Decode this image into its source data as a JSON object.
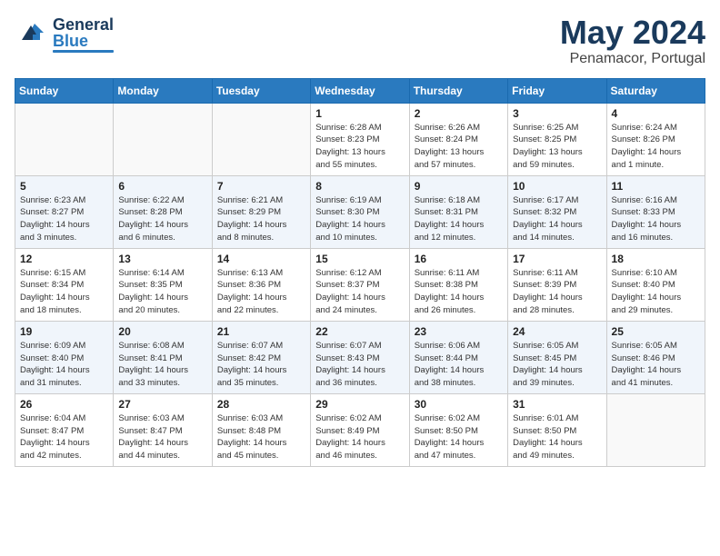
{
  "header": {
    "logo_general": "General",
    "logo_blue": "Blue",
    "month_title": "May 2024",
    "location": "Penamacor, Portugal"
  },
  "days_of_week": [
    "Sunday",
    "Monday",
    "Tuesday",
    "Wednesday",
    "Thursday",
    "Friday",
    "Saturday"
  ],
  "weeks": [
    [
      {
        "day": "",
        "info": ""
      },
      {
        "day": "",
        "info": ""
      },
      {
        "day": "",
        "info": ""
      },
      {
        "day": "1",
        "info": "Sunrise: 6:28 AM\nSunset: 8:23 PM\nDaylight: 13 hours\nand 55 minutes."
      },
      {
        "day": "2",
        "info": "Sunrise: 6:26 AM\nSunset: 8:24 PM\nDaylight: 13 hours\nand 57 minutes."
      },
      {
        "day": "3",
        "info": "Sunrise: 6:25 AM\nSunset: 8:25 PM\nDaylight: 13 hours\nand 59 minutes."
      },
      {
        "day": "4",
        "info": "Sunrise: 6:24 AM\nSunset: 8:26 PM\nDaylight: 14 hours\nand 1 minute."
      }
    ],
    [
      {
        "day": "5",
        "info": "Sunrise: 6:23 AM\nSunset: 8:27 PM\nDaylight: 14 hours\nand 3 minutes."
      },
      {
        "day": "6",
        "info": "Sunrise: 6:22 AM\nSunset: 8:28 PM\nDaylight: 14 hours\nand 6 minutes."
      },
      {
        "day": "7",
        "info": "Sunrise: 6:21 AM\nSunset: 8:29 PM\nDaylight: 14 hours\nand 8 minutes."
      },
      {
        "day": "8",
        "info": "Sunrise: 6:19 AM\nSunset: 8:30 PM\nDaylight: 14 hours\nand 10 minutes."
      },
      {
        "day": "9",
        "info": "Sunrise: 6:18 AM\nSunset: 8:31 PM\nDaylight: 14 hours\nand 12 minutes."
      },
      {
        "day": "10",
        "info": "Sunrise: 6:17 AM\nSunset: 8:32 PM\nDaylight: 14 hours\nand 14 minutes."
      },
      {
        "day": "11",
        "info": "Sunrise: 6:16 AM\nSunset: 8:33 PM\nDaylight: 14 hours\nand 16 minutes."
      }
    ],
    [
      {
        "day": "12",
        "info": "Sunrise: 6:15 AM\nSunset: 8:34 PM\nDaylight: 14 hours\nand 18 minutes."
      },
      {
        "day": "13",
        "info": "Sunrise: 6:14 AM\nSunset: 8:35 PM\nDaylight: 14 hours\nand 20 minutes."
      },
      {
        "day": "14",
        "info": "Sunrise: 6:13 AM\nSunset: 8:36 PM\nDaylight: 14 hours\nand 22 minutes."
      },
      {
        "day": "15",
        "info": "Sunrise: 6:12 AM\nSunset: 8:37 PM\nDaylight: 14 hours\nand 24 minutes."
      },
      {
        "day": "16",
        "info": "Sunrise: 6:11 AM\nSunset: 8:38 PM\nDaylight: 14 hours\nand 26 minutes."
      },
      {
        "day": "17",
        "info": "Sunrise: 6:11 AM\nSunset: 8:39 PM\nDaylight: 14 hours\nand 28 minutes."
      },
      {
        "day": "18",
        "info": "Sunrise: 6:10 AM\nSunset: 8:40 PM\nDaylight: 14 hours\nand 29 minutes."
      }
    ],
    [
      {
        "day": "19",
        "info": "Sunrise: 6:09 AM\nSunset: 8:40 PM\nDaylight: 14 hours\nand 31 minutes."
      },
      {
        "day": "20",
        "info": "Sunrise: 6:08 AM\nSunset: 8:41 PM\nDaylight: 14 hours\nand 33 minutes."
      },
      {
        "day": "21",
        "info": "Sunrise: 6:07 AM\nSunset: 8:42 PM\nDaylight: 14 hours\nand 35 minutes."
      },
      {
        "day": "22",
        "info": "Sunrise: 6:07 AM\nSunset: 8:43 PM\nDaylight: 14 hours\nand 36 minutes."
      },
      {
        "day": "23",
        "info": "Sunrise: 6:06 AM\nSunset: 8:44 PM\nDaylight: 14 hours\nand 38 minutes."
      },
      {
        "day": "24",
        "info": "Sunrise: 6:05 AM\nSunset: 8:45 PM\nDaylight: 14 hours\nand 39 minutes."
      },
      {
        "day": "25",
        "info": "Sunrise: 6:05 AM\nSunset: 8:46 PM\nDaylight: 14 hours\nand 41 minutes."
      }
    ],
    [
      {
        "day": "26",
        "info": "Sunrise: 6:04 AM\nSunset: 8:47 PM\nDaylight: 14 hours\nand 42 minutes."
      },
      {
        "day": "27",
        "info": "Sunrise: 6:03 AM\nSunset: 8:47 PM\nDaylight: 14 hours\nand 44 minutes."
      },
      {
        "day": "28",
        "info": "Sunrise: 6:03 AM\nSunset: 8:48 PM\nDaylight: 14 hours\nand 45 minutes."
      },
      {
        "day": "29",
        "info": "Sunrise: 6:02 AM\nSunset: 8:49 PM\nDaylight: 14 hours\nand 46 minutes."
      },
      {
        "day": "30",
        "info": "Sunrise: 6:02 AM\nSunset: 8:50 PM\nDaylight: 14 hours\nand 47 minutes."
      },
      {
        "day": "31",
        "info": "Sunrise: 6:01 AM\nSunset: 8:50 PM\nDaylight: 14 hours\nand 49 minutes."
      },
      {
        "day": "",
        "info": ""
      }
    ]
  ]
}
